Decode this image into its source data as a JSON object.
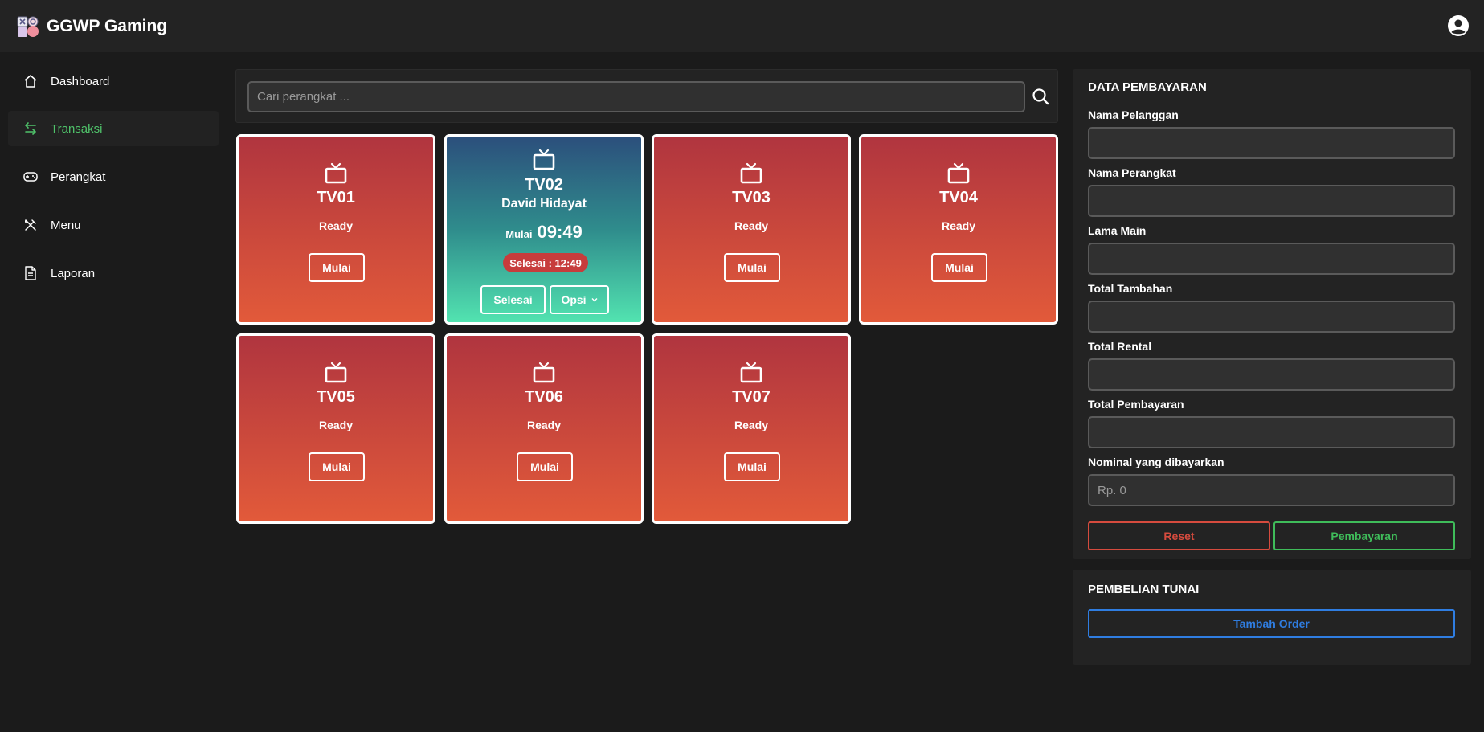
{
  "app": {
    "title": "GGWP Gaming"
  },
  "sidebar": {
    "items": [
      {
        "label": "Dashboard",
        "icon": "home-icon"
      },
      {
        "label": "Transaksi",
        "icon": "transfer-icon",
        "active": true
      },
      {
        "label": "Perangkat",
        "icon": "gamepad-icon"
      },
      {
        "label": "Menu",
        "icon": "utensils-icon"
      },
      {
        "label": "Laporan",
        "icon": "document-icon"
      }
    ]
  },
  "search": {
    "placeholder": "Cari perangkat ..."
  },
  "devices": [
    {
      "name": "TV01",
      "status": "Ready",
      "button": "Mulai"
    },
    {
      "name": "TV02",
      "customer": "David Hidayat",
      "start_label": "Mulai",
      "start_time": "09:49",
      "end_badge": "Selesai : 12:49",
      "finish_button": "Selesai",
      "options_button": "Opsi"
    },
    {
      "name": "TV03",
      "status": "Ready",
      "button": "Mulai"
    },
    {
      "name": "TV04",
      "status": "Ready",
      "button": "Mulai"
    },
    {
      "name": "TV05",
      "status": "Ready",
      "button": "Mulai"
    },
    {
      "name": "TV06",
      "status": "Ready",
      "button": "Mulai"
    },
    {
      "name": "TV07",
      "status": "Ready",
      "button": "Mulai"
    }
  ],
  "payment": {
    "title": "DATA PEMBAYARAN",
    "fields": [
      {
        "label": "Nama Pelanggan",
        "value": "",
        "placeholder": ""
      },
      {
        "label": "Nama Perangkat",
        "value": "",
        "placeholder": ""
      },
      {
        "label": "Lama Main",
        "value": "",
        "placeholder": ""
      },
      {
        "label": "Total Tambahan",
        "value": "",
        "placeholder": ""
      },
      {
        "label": "Total Rental",
        "value": "",
        "placeholder": ""
      },
      {
        "label": "Total Pembayaran",
        "value": "",
        "placeholder": ""
      },
      {
        "label": "Nominal yang dibayarkan",
        "value": "",
        "placeholder": "Rp. 0"
      }
    ],
    "reset_label": "Reset",
    "pay_label": "Pembayaran"
  },
  "cash_purchase": {
    "title": "PEMBELIAN TUNAI",
    "add_order_label": "Tambah Order"
  },
  "colors": {
    "background": "#1b1b1b",
    "panel": "#232323",
    "accent_green": "#4fc36a",
    "card_red_top": "#b0353f",
    "card_red_bottom": "#e25a3a",
    "reset_red": "#d64b3e",
    "pay_green": "#3fbc5a",
    "order_blue": "#2f7de1"
  }
}
